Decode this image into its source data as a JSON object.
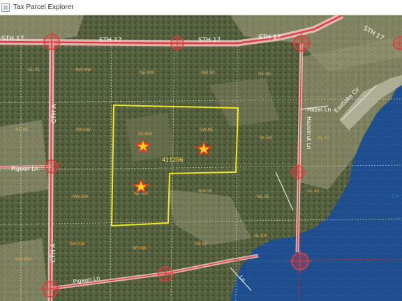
{
  "window": {
    "title": "Tax Parcel Explorer",
    "icon": "map-app-icon"
  },
  "map": {
    "parcel_id_label": "411206",
    "colors": {
      "selected_parcel_outline": "#f2e81e",
      "road_centerline": "#e23b3b",
      "road_casing": "#f4c3c3",
      "parcel_label": "#f0a640",
      "lake": "#1f4e8e",
      "marker_star": "#ff2a1a"
    },
    "road_labels": [
      {
        "text": "STH 17"
      },
      {
        "text": "STH 17"
      },
      {
        "text": "STH 17"
      },
      {
        "text": "STH 17"
      },
      {
        "text": "STH 17"
      },
      {
        "text": "CTH A"
      },
      {
        "text": "CTH A"
      },
      {
        "text": "Pigeon Ln"
      },
      {
        "text": "Pigeon Ln"
      },
      {
        "text": "Hazelnut Ln"
      },
      {
        "text": "Hazel Ln"
      },
      {
        "text": "Eastlake Cir"
      },
      {
        "text": "Ln"
      }
    ],
    "parcel_labels": [
      "NW-NW",
      "NE-NW",
      "NW-NE",
      "NE-NE",
      "GL 01",
      "SW-NW",
      "SE-NW",
      "SW-NE",
      "SE-NE",
      "GL 02",
      "NW-SW",
      "NE-SW",
      "NW-SE",
      "NE-SE",
      "GL 03",
      "SW-SW",
      "SE-SW",
      "SW-SE",
      "GL 04",
      "NE-NE",
      "NW-NW"
    ],
    "markers": [
      {
        "icon": "star-marker-icon"
      },
      {
        "icon": "star-marker-icon"
      },
      {
        "icon": "star-marker-icon"
      }
    ],
    "intersections": [
      {
        "icon": "crosshair-circle-icon"
      },
      {
        "icon": "crosshair-circle-icon"
      },
      {
        "icon": "crosshair-circle-icon"
      },
      {
        "icon": "crosshair-circle-icon"
      },
      {
        "icon": "crosshair-circle-icon"
      },
      {
        "icon": "crosshair-circle-icon"
      },
      {
        "icon": "crosshair-circle-icon"
      },
      {
        "icon": "crosshair-circle-icon"
      },
      {
        "icon": "crosshair-circle-icon"
      }
    ],
    "lake_label": "Lo"
  }
}
